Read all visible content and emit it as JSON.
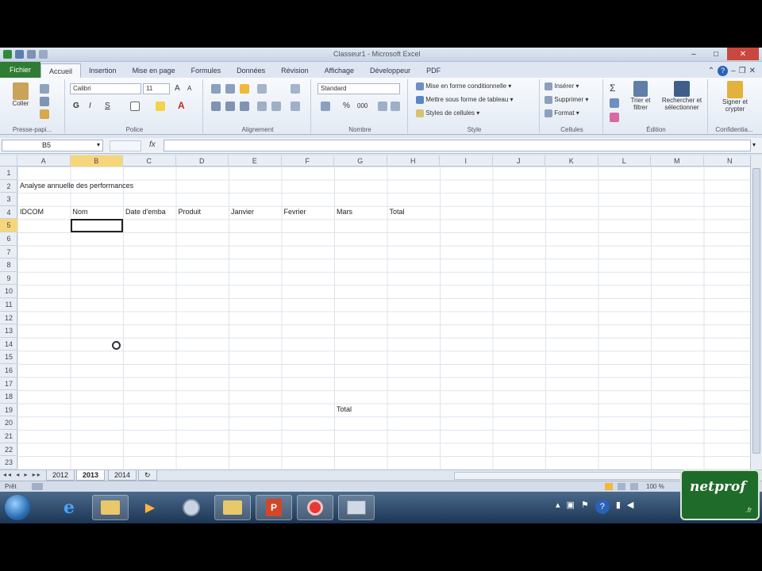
{
  "window": {
    "title": "Classeur1 - Microsoft Excel"
  },
  "ribbon_tabs": [
    "Fichier",
    "Accueil",
    "Insertion",
    "Mise en page",
    "Formules",
    "Données",
    "Révision",
    "Affichage",
    "Développeur",
    "PDF"
  ],
  "ribbon": {
    "clipboard": {
      "paste_label": "Coller",
      "group_label": "Presse-papi..."
    },
    "font": {
      "font_name": "Calibri",
      "font_size": "11",
      "bold": "G",
      "italic": "I",
      "underline": "S",
      "grow": "A",
      "shrink": "A",
      "group_label": "Police"
    },
    "alignment": {
      "group_label": "Alignement"
    },
    "number": {
      "format": "Standard",
      "percent": "%",
      "thousands": "000",
      "group_label": "Nombre"
    },
    "style": {
      "items": [
        "Mise en forme conditionnelle",
        "Mettre sous forme de tableau",
        "Styles de cellules"
      ],
      "group_label": "Style"
    },
    "cells": {
      "items": [
        "Insérer",
        "Supprimer",
        "Format"
      ],
      "group_label": "Cellules"
    },
    "editing": {
      "sum": "Σ",
      "sort_label": "Trier et filtrer",
      "find_label": "Rechercher et sélectionner",
      "group_label": "Édition"
    },
    "confidential": {
      "sign_label": "Signer et crypter",
      "group_label": "Confidentia..."
    }
  },
  "formula_bar": {
    "name_box": "B5",
    "fx": "fx",
    "value": ""
  },
  "columns": [
    "A",
    "B",
    "C",
    "D",
    "E",
    "F",
    "G",
    "H",
    "I",
    "J",
    "K",
    "L",
    "M",
    "N"
  ],
  "selected_column": "B",
  "rows": [
    "1",
    "2",
    "3",
    "4",
    "5",
    "6",
    "7",
    "8",
    "9",
    "10",
    "11",
    "12",
    "13",
    "14",
    "15",
    "16",
    "17",
    "18",
    "19",
    "20",
    "21",
    "22",
    "23"
  ],
  "selected_row": "5",
  "cells": {
    "A2": "Analyse annuelle des performances",
    "A4": "IDCOM",
    "B4": "Nom",
    "C4": "Date d'emba",
    "D4": "Produit",
    "E4": "Janvier",
    "F4": "Fevrier",
    "G4": "Mars",
    "H4": "Total",
    "G19": "Total"
  },
  "sheet_tabs": [
    "2012",
    "2013",
    "2014"
  ],
  "active_sheet": "2013",
  "status": {
    "left": "Prêt",
    "zoom": "100 %"
  },
  "logo": {
    "text": "netprof",
    "sub": ".fr"
  },
  "colors": {
    "file_tab": "#2e7d32",
    "selection_header": "#f7d67a",
    "logo_bg": "#1f6b2a"
  }
}
